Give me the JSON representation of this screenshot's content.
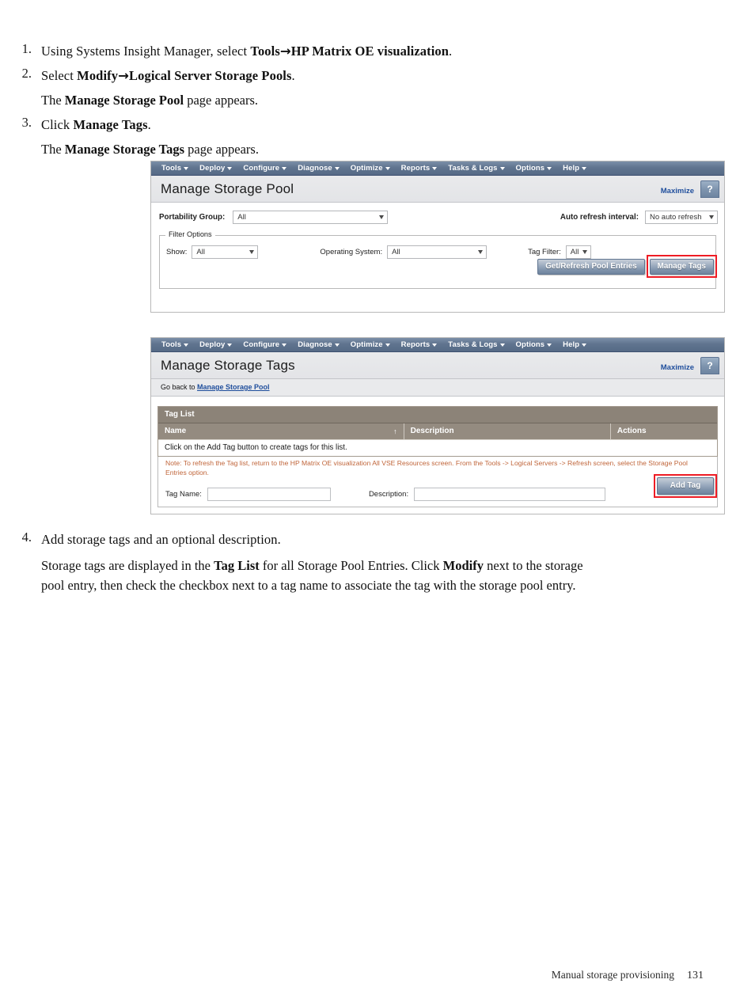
{
  "document": {
    "steps": [
      {
        "num": "1.",
        "segments": [
          {
            "t": "Using Systems Insight Manager, select ",
            "b": false
          },
          {
            "t": "Tools",
            "b": true
          },
          {
            "t": "→",
            "b": true
          },
          {
            "t": "HP Matrix OE visualization",
            "b": true
          },
          {
            "t": ".",
            "b": false
          }
        ]
      },
      {
        "num": "2.",
        "segments": [
          {
            "t": "Select ",
            "b": false
          },
          {
            "t": "Modify",
            "b": true
          },
          {
            "t": "→",
            "b": true
          },
          {
            "t": "Logical Server Storage Pools",
            "b": true
          },
          {
            "t": ".",
            "b": false
          }
        ],
        "sub": [
          {
            "t": "The ",
            "b": false
          },
          {
            "t": "Manage Storage Pool",
            "b": true
          },
          {
            "t": " page appears.",
            "b": false
          }
        ]
      },
      {
        "num": "3.",
        "segments": [
          {
            "t": "Click ",
            "b": false
          },
          {
            "t": "Manage Tags",
            "b": true
          },
          {
            "t": ".",
            "b": false
          }
        ],
        "sub": [
          {
            "t": "The ",
            "b": false
          },
          {
            "t": "Manage Storage Tags",
            "b": true
          },
          {
            "t": " page appears.",
            "b": false
          }
        ]
      },
      {
        "num": "4.",
        "segments": [
          {
            "t": "Add storage tags and an optional description.",
            "b": false
          }
        ],
        "sub": [
          {
            "t": "Storage tags are displayed in the ",
            "b": false
          },
          {
            "t": "Tag List",
            "b": true
          },
          {
            "t": " for all Storage Pool Entries. Click ",
            "b": false
          },
          {
            "t": "Modify",
            "b": true
          },
          {
            "t": " next to the storage pool entry, then check the checkbox next to a tag name to associate the tag with the storage pool entry.",
            "b": false
          }
        ]
      }
    ],
    "footer": {
      "chapter": "Manual storage provisioning",
      "page": "131"
    }
  },
  "menu": {
    "items": [
      {
        "label": "Tools"
      },
      {
        "label": "Deploy"
      },
      {
        "label": "Configure"
      },
      {
        "label": "Diagnose"
      },
      {
        "label": "Optimize"
      },
      {
        "label": "Reports"
      },
      {
        "label": "Tasks & Logs"
      },
      {
        "label": "Options"
      },
      {
        "label": "Help"
      }
    ]
  },
  "storage_pool": {
    "title": "Manage Storage Pool",
    "maximize_label": "Maximize",
    "help_label": "?",
    "portability_group": {
      "label": "Portability Group:",
      "value": "All"
    },
    "auto_refresh": {
      "label": "Auto refresh interval:",
      "value": "No auto refresh"
    },
    "filter_options": {
      "legend": "Filter Options",
      "show": {
        "label": "Show:",
        "value": "All"
      },
      "operating_system": {
        "label": "Operating System:",
        "value": "All"
      },
      "tag_filter": {
        "label": "Tag Filter:",
        "value": "All"
      },
      "get_refresh_button": "Get/Refresh Pool Entries",
      "manage_tags_button": "Manage Tags"
    }
  },
  "storage_tags": {
    "title": "Manage Storage Tags",
    "maximize_label": "Maximize",
    "help_label": "?",
    "go_back": {
      "prefix": "Go back to ",
      "link": "Manage Storage Pool"
    },
    "tag_list": {
      "caption": "Tag List",
      "columns": [
        "Name",
        "Description",
        "Actions"
      ],
      "sort_indicator": "↑",
      "empty_message": "Click on the Add Tag button to create tags for this list."
    },
    "note": "Note: To refresh the Tag list, return to the HP Matrix OE visualization All VSE Resources screen. From the Tools -> Logical Servers -> Refresh screen, select the Storage Pool Entries option.",
    "form": {
      "tag_name_label": "Tag Name:",
      "tag_name_value": "",
      "description_label": "Description:",
      "description_value": "",
      "add_tag_button": "Add Tag"
    }
  },
  "colors": {
    "menubar": "#60748f",
    "table_header": "#8c8378",
    "note_text": "#c0653a",
    "highlight_box": "#ee1c25",
    "link": "#1f4e9c"
  }
}
